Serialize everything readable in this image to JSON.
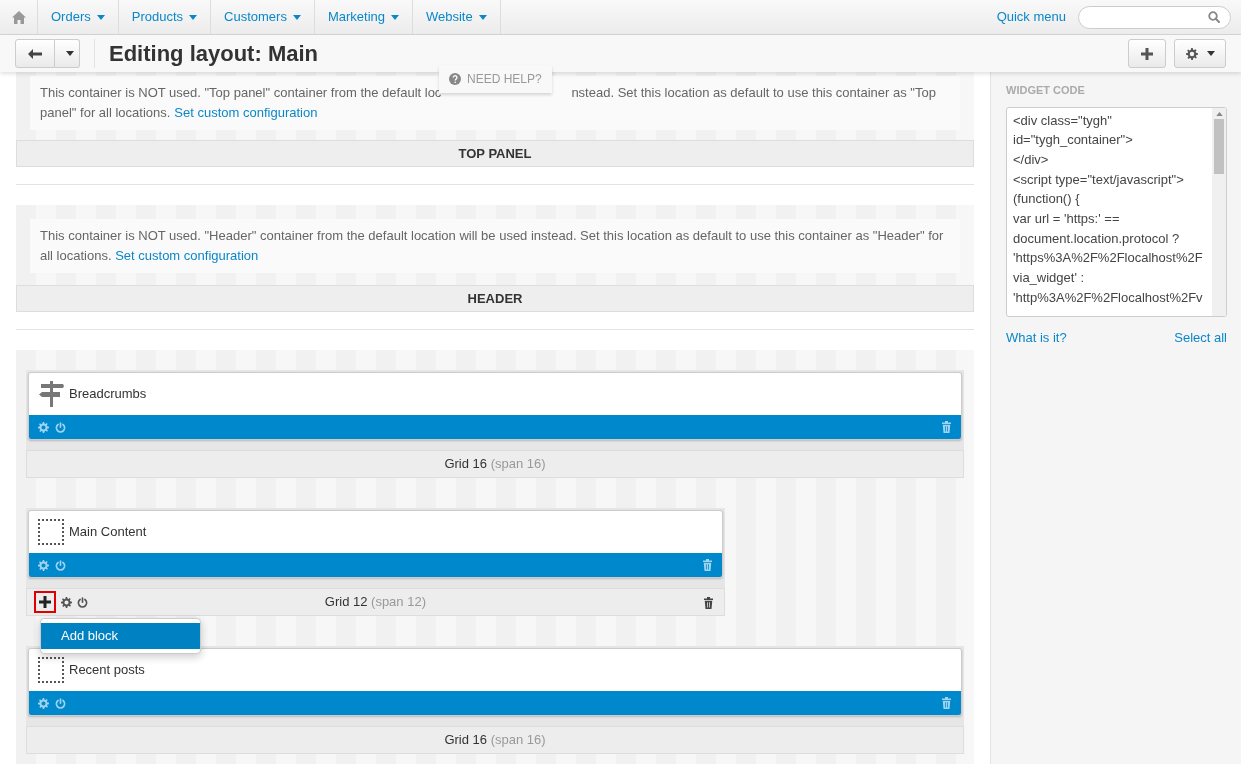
{
  "nav": {
    "items": [
      {
        "label": "Orders"
      },
      {
        "label": "Products"
      },
      {
        "label": "Customers"
      },
      {
        "label": "Marketing"
      },
      {
        "label": "Website"
      }
    ],
    "quick_menu": "Quick menu"
  },
  "toolbar": {
    "title": "Editing layout: Main",
    "need_help": "NEED HELP?"
  },
  "containers": [
    {
      "kind": "notice",
      "notice_line1_before": "This container is NOT used. \"Top panel\" container from the default loc",
      "notice_line1_after": "nstead. Set this location as default to use this container as \"Top",
      "notice_line2": "panel\" for all locations.",
      "link": "Set custom configuration",
      "title": "TOP PANEL"
    },
    {
      "kind": "notice",
      "notice_text": "This container is NOT used. \"Header\" container from the default location will be used instead. Set this location as default to use this container as \"Header\" for all locations.",
      "link": "Set custom configuration",
      "title": "HEADER"
    },
    {
      "kind": "grids",
      "grids": [
        {
          "kind": "wide",
          "controls": false,
          "blocks": [
            {
              "name": "Breadcrumbs",
              "kind": "signpost"
            }
          ],
          "label": "Grid 16",
          "span": "(span 16)"
        },
        {
          "kind": "narrow",
          "controls": true,
          "add_highlighted": true,
          "menu": {
            "items": [
              {
                "label": "Add block",
                "selected": true
              }
            ]
          },
          "blocks": [
            {
              "name": "Main Content",
              "kind": "empty"
            }
          ],
          "label": "Grid 12",
          "span": "(span 12)"
        },
        {
          "kind": "wide",
          "controls": false,
          "blocks": [
            {
              "name": "Recent posts",
              "kind": "empty"
            }
          ],
          "label": "Grid 16",
          "span": "(span 16)"
        }
      ]
    }
  ],
  "sidebar": {
    "heading": "WIDGET CODE",
    "code_lines": [
      "<div class=\"tygh\"",
      "id=\"tygh_container\">",
      "</div>",
      "<script type=\"text/javascript\">",
      "(function() {",
      "var url = 'https:' ==",
      "document.location.protocol ?",
      "'https%3A%2F%2Flocalhost%2F",
      "via_widget' :",
      "'http%3A%2F%2Flocalhost%2Fv"
    ],
    "link_left": "What is it?",
    "link_right": "Select all"
  }
}
